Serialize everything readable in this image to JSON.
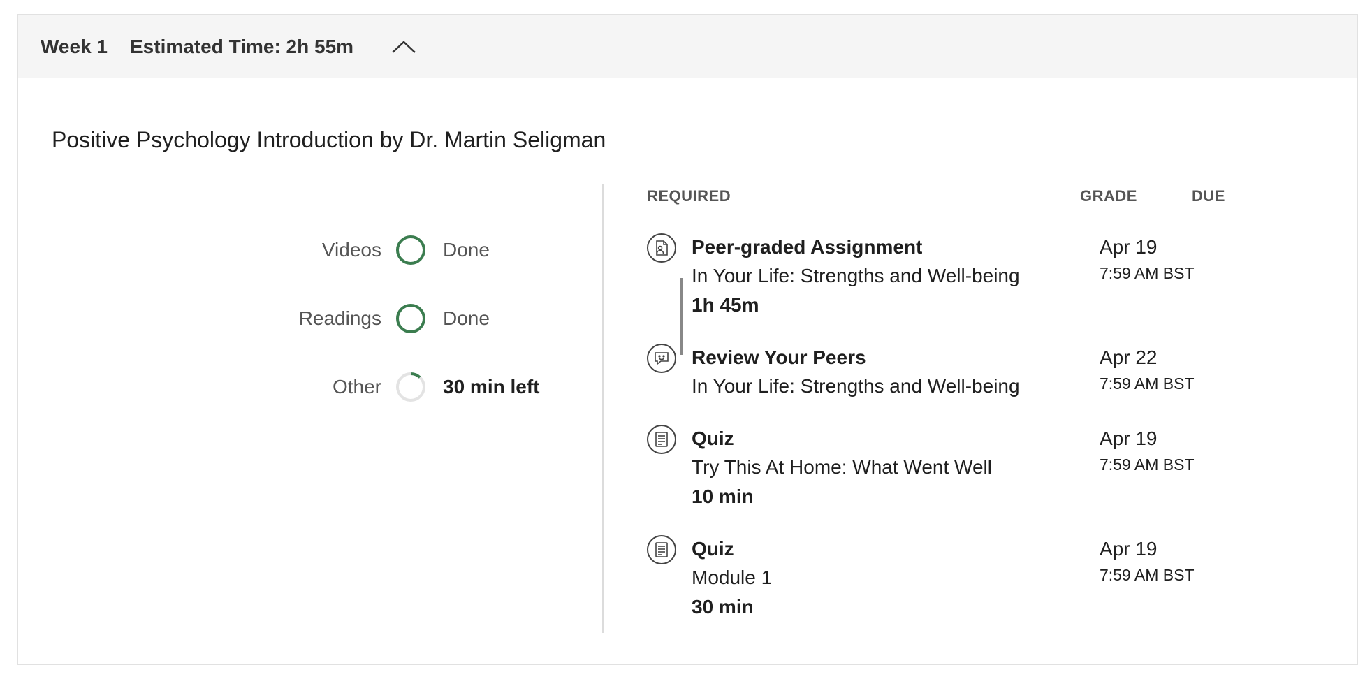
{
  "week": {
    "label": "Week 1",
    "estimated_time": "Estimated Time: 2h 55m"
  },
  "module_title": "Positive Psychology Introduction by Dr. Martin Seligman",
  "progress": [
    {
      "label": "Videos",
      "status": "Done",
      "fraction": 1.0,
      "ring_color": "#3b7d4f"
    },
    {
      "label": "Readings",
      "status": "Done",
      "fraction": 1.0,
      "ring_color": "#3b7d4f"
    },
    {
      "label": "Other",
      "status": "30 min left",
      "fraction": 0.12,
      "ring_color": "#3b7d4f"
    }
  ],
  "columns": {
    "required": "REQUIRED",
    "grade": "GRADE",
    "due": "DUE"
  },
  "items": [
    {
      "icon": "peer-assignment-icon",
      "type": "Peer-graded Assignment",
      "name": "In Your Life: Strengths and Well-being",
      "duration": "1h 45m",
      "due_date": "Apr 19",
      "due_time": "7:59 AM BST"
    },
    {
      "icon": "review-peers-icon",
      "type": "Review Your Peers",
      "name": "In Your Life: Strengths and Well-being",
      "duration": "",
      "due_date": "Apr 22",
      "due_time": "7:59 AM BST"
    },
    {
      "icon": "quiz-icon",
      "type": "Quiz",
      "name": "Try This At Home: What Went Well",
      "duration": "10 min",
      "due_date": "Apr 19",
      "due_time": "7:59 AM BST"
    },
    {
      "icon": "quiz-icon",
      "type": "Quiz",
      "name": "Module 1",
      "duration": "30 min",
      "due_date": "Apr 19",
      "due_time": "7:59 AM BST"
    }
  ]
}
